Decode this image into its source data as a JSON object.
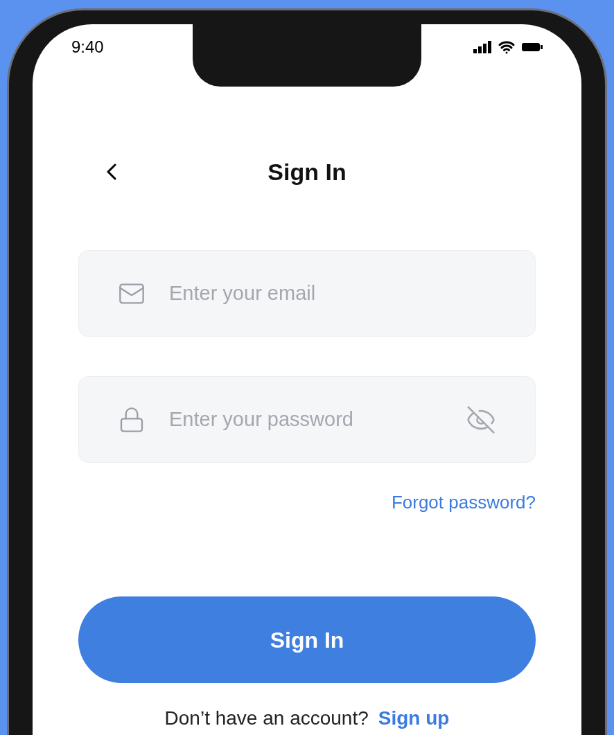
{
  "status_bar": {
    "time": "9:40"
  },
  "header": {
    "title": "Sign In"
  },
  "fields": [
    {
      "kind": "email",
      "placeholder": "Enter your email"
    },
    {
      "kind": "password",
      "placeholder": "Enter your password"
    }
  ],
  "forgot_link": "Forgot password?",
  "primary_button": "Sign In",
  "footer": {
    "text": "Don’t have an account?",
    "link": "Sign up"
  }
}
